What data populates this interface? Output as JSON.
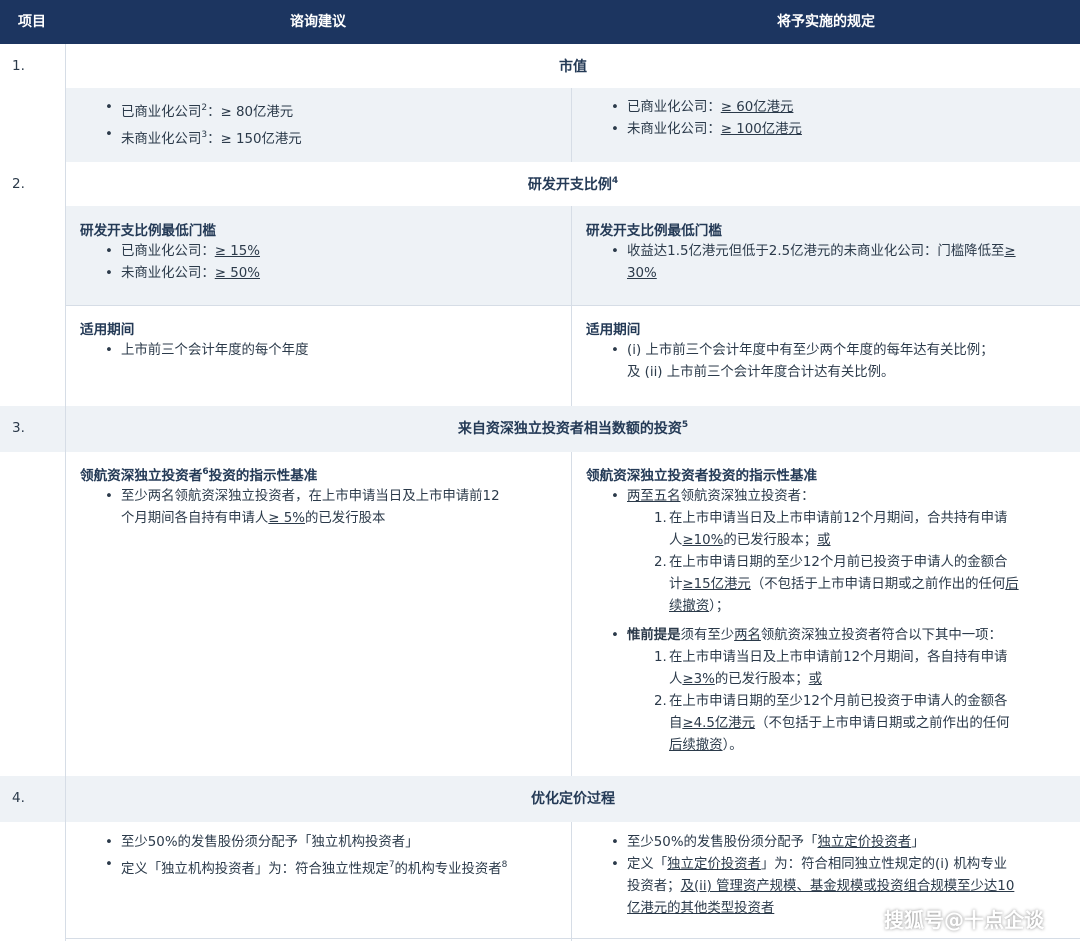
{
  "header": {
    "col_item": "项目",
    "col_advice": "谘询建议",
    "col_rules": "将予实施的规定"
  },
  "s1": {
    "num": "1.",
    "title": "市值",
    "left": [
      {
        "pre": "已商业化公司",
        "sup": "2",
        "post": "：≥ 80亿港元"
      },
      {
        "pre": "未商业化公司",
        "sup": "3",
        "post": "：≥ 150亿港元"
      }
    ],
    "right": [
      {
        "pre": "已商业化公司：",
        "val": "≥ 60亿港元"
      },
      {
        "pre": "未商业化公司：",
        "val": "≥ 100亿港元"
      }
    ]
  },
  "s2": {
    "num": "2.",
    "title": "研发开支比例",
    "title_sup": "4",
    "threshold_heading": "研发开支比例最低门槛",
    "left": [
      {
        "pre": "已商业化公司：",
        "val": "≥ 15%"
      },
      {
        "pre": "未商业化公司：",
        "val": "≥ 50%"
      }
    ],
    "right_line1_pre": "收益达1.5亿港元但低于2.5亿港元的未商业化公司：门槛降低至",
    "right_line1_val": "≥",
    "right_line2_val": "30%",
    "period_heading": "适用期间",
    "period_left": "上市前三个会计年度的每个年度",
    "period_right_1": "(i) 上市前三个会计年度中有至少两个年度的每年达有关比例；",
    "period_right_2": "及 (ii) 上市前三个会计年度合计达有关比例。"
  },
  "s3": {
    "num": "3.",
    "title": "来自资深独立投资者相当数额的投资",
    "title_sup": "5",
    "left_heading_pre": "领航资深独立投资者",
    "left_heading_sup": "6",
    "left_heading_post": "投资的指示性基准",
    "left_l1": "至少两名领航资深独立投资者，在上市申请当日及上市申请前12",
    "left_l2_pre": "个月期间各自持有申请人",
    "left_l2_val": "≥ 5%",
    "left_l2_post": "的已发行股本",
    "right_heading": "领航资深独立投资者投资的指示性基准",
    "r_b1_val": "两至五名",
    "r_b1_post": "领航资深独立投资者：",
    "r_b1_i1_l1": "在上市申请当日及上市申请前12个月期间，合共持有申请",
    "r_b1_i1_l2_pre": "人",
    "r_b1_i1_l2_val": "≥10%",
    "r_b1_i1_l2_post": "的已发行股本；",
    "r_b1_i1_l2_or": "或",
    "r_b1_i2_l1": "在上市申请日期的至少12个月前已投资于申请人的金额合",
    "r_b1_i2_l2_pre": "计",
    "r_b1_i2_l2_val": "≥15亿港元",
    "r_b1_i2_l2_post": "（不包括于上市申请日期或之前作出的任何",
    "r_b1_i2_l2_u": "后",
    "r_b1_i2_l3_u": "续撤资",
    "r_b1_i2_l3_post": "）；",
    "r_b2_bold": "惟前提是",
    "r_b2_pre": "须有至少",
    "r_b2_val": "两名",
    "r_b2_post": "领航资深独立投资者符合以下其中一项：",
    "r_b2_i1_l1": "在上市申请当日及上市申请前12个月期间，各自持有申请",
    "r_b2_i1_l2_pre": "人",
    "r_b2_i1_l2_val": "≥3%",
    "r_b2_i1_l2_post": "的已发行股本；",
    "r_b2_i1_l2_or": "或",
    "r_b2_i2_l1": "在上市申请日期的至少12个月前已投资于申请人的金额各",
    "r_b2_i2_l2_pre": "自",
    "r_b2_i2_l2_val": "≥4.5亿港元",
    "r_b2_i2_l2_post": "（不包括于上市申请日期或之前作出的任何",
    "r_b2_i2_l3_u": "后续撤资",
    "r_b2_i2_l3_post": "）。"
  },
  "s4": {
    "num": "4.",
    "title": "优化定价过程",
    "left_b1": "至少50%的发售股份须分配予「独立机构投资者」",
    "left_b2_pre": "定义「独立机构投资者」为：符合独立性规定",
    "left_b2_sup1": "7",
    "left_b2_mid": "的机构专业投资者",
    "left_b2_sup2": "8",
    "right_b1_pre": "至少50%的发售股份须分配予「",
    "right_b1_u": "独立定价投资者",
    "right_b1_post": "」",
    "right_b2_l1_pre": "定义「",
    "right_b2_l1_u": "独立定价投资者",
    "right_b2_l1_post": "」为：符合相同独立性规定的(i) 机构专业",
    "right_b2_l2_pre": "投资者；",
    "right_b2_l2_u": "及(ii) 管理资产规模、基金规模或投资组合规模至少达10",
    "right_b2_l3_u": "亿港元的其他类型投资者"
  },
  "watermark": "搜狐号@十点企谈"
}
